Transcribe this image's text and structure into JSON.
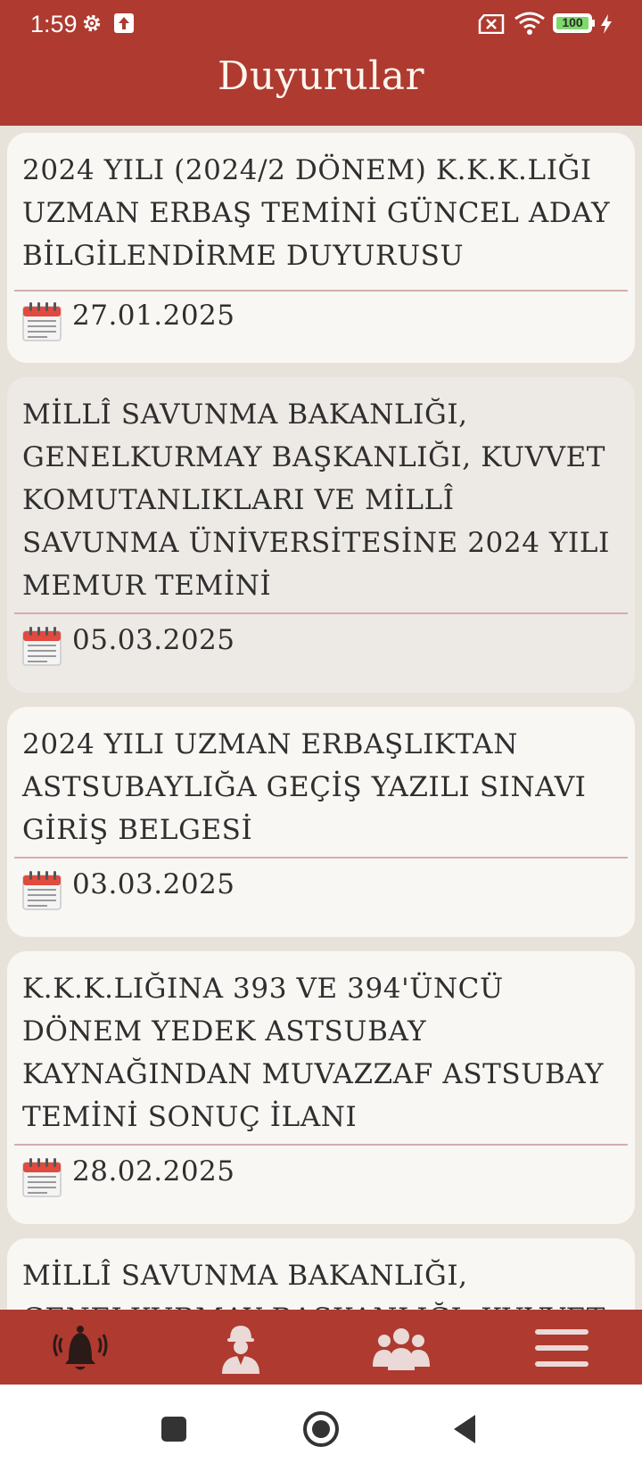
{
  "status_bar": {
    "time": "1:59",
    "battery": "100",
    "icons": [
      "gear-icon",
      "upload-icon",
      "sim-off-icon",
      "wifi-icon",
      "battery-icon",
      "charging-bolt-icon"
    ]
  },
  "header": {
    "title": "Duyurular"
  },
  "announcements": [
    {
      "title": "2024 YILI (2024/2 DÖNEM) K.K.K.LIĞI UZMAN ERBAŞ TEMİNİ GÜNCEL ADAY BİLGİLENDİRME DUYURUSU",
      "date": "27.01.2025"
    },
    {
      "title": "MİLLÎ SAVUNMA BAKANLIĞI, GENELKURMAY BAŞKANLIĞI, KUVVET KOMUTANLIKLARI VE MİLLÎ SAVUNMA ÜNİVERSİTESİNE 2024 YILI MEMUR TEMİNİ",
      "date": "05.03.2025"
    },
    {
      "title": "2024 YILI UZMAN ERBAŞLIKTAN ASTSUBAYLIĞA GEÇİŞ YAZILI SINAVI GİRİŞ BELGESİ",
      "date": "03.03.2025"
    },
    {
      "title": "K.K.K.LIĞINA 393 VE 394'ÜNCÜ DÖNEM YEDEK ASTSUBAY KAYNAĞINDAN MUVAZZAF ASTSUBAY TEMİNİ SONUÇ İLANI",
      "date": "28.02.2025"
    },
    {
      "title": "MİLLÎ SAVUNMA BAKANLIĞI, GENELKURMAY BAŞKANLIĞI, KUVVET",
      "date": ""
    }
  ],
  "bottom_nav": {
    "items": [
      "bell-icon",
      "soldier-icon",
      "group-icon",
      "menu-icon"
    ],
    "active": "bell-icon"
  },
  "system_nav": [
    "recents-button",
    "home-button",
    "back-button"
  ],
  "colors": {
    "primary": "#ae3a30",
    "card": "#f8f7f4",
    "card_alt": "#ede9e5",
    "background": "#e8e3da"
  }
}
